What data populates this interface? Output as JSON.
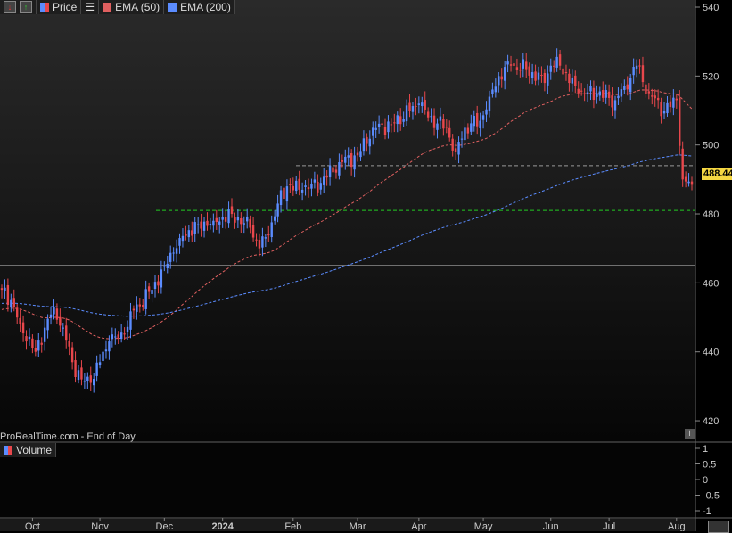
{
  "legend": {
    "price": "Price",
    "ema50": "EMA (50)",
    "ema200": "EMA (200)",
    "volume": "Volume"
  },
  "source": "ProRealTime.com - End of Day",
  "last_price": "488.44",
  "colors": {
    "up": "#5b8cff",
    "down": "#e8474c",
    "ema50": "#e06060",
    "ema200": "#5b8cff",
    "last": "#f5d742"
  },
  "chart_data": {
    "type": "candlestick",
    "title": "",
    "ylim": [
      415,
      542
    ],
    "y_ticks": [
      "540",
      "520",
      "500",
      "480",
      "460",
      "440",
      "420"
    ],
    "y_tick_values": [
      540,
      520,
      500,
      480,
      460,
      440,
      420
    ],
    "x_labels": [
      "Oct",
      "Nov",
      "Dec",
      "2024",
      "Feb",
      "Mar",
      "Apr",
      "May",
      "Jun",
      "Jul",
      "Aug"
    ],
    "x_label_bar_index": [
      10,
      32,
      53,
      72,
      95,
      116,
      136,
      157,
      179,
      198,
      220
    ],
    "total_bars": 226,
    "close_keypoints": [
      [
        0,
        458
      ],
      [
        3,
        455
      ],
      [
        6,
        448
      ],
      [
        11,
        440
      ],
      [
        14,
        447
      ],
      [
        17,
        453
      ],
      [
        20,
        447
      ],
      [
        23,
        437
      ],
      [
        26,
        432
      ],
      [
        29,
        431
      ],
      [
        32,
        437
      ],
      [
        35,
        443
      ],
      [
        40,
        445
      ],
      [
        43,
        452
      ],
      [
        49,
        458
      ],
      [
        53,
        465
      ],
      [
        58,
        473
      ],
      [
        64,
        477
      ],
      [
        69,
        478
      ],
      [
        75,
        480
      ],
      [
        81,
        476
      ],
      [
        84,
        470
      ],
      [
        87,
        474
      ],
      [
        90,
        483
      ],
      [
        93,
        488
      ],
      [
        98,
        487
      ],
      [
        104,
        489
      ],
      [
        110,
        495
      ],
      [
        116,
        497
      ],
      [
        121,
        505
      ],
      [
        127,
        506
      ],
      [
        133,
        510
      ],
      [
        136,
        512
      ],
      [
        139,
        508
      ],
      [
        145,
        505
      ],
      [
        148,
        498
      ],
      [
        151,
        505
      ],
      [
        156,
        507
      ],
      [
        159,
        514
      ],
      [
        162,
        520
      ],
      [
        166,
        523
      ],
      [
        171,
        522
      ],
      [
        177,
        518
      ],
      [
        179,
        523
      ],
      [
        182,
        523
      ],
      [
        188,
        515
      ],
      [
        194,
        515
      ],
      [
        200,
        513
      ],
      [
        203,
        517
      ],
      [
        207,
        523
      ],
      [
        211,
        515
      ],
      [
        216,
        510
      ],
      [
        220,
        513
      ],
      [
        222,
        490
      ],
      [
        225,
        488.44
      ]
    ],
    "levels": [
      {
        "value": 465,
        "style": "solid",
        "color": "#cccccc"
      },
      {
        "value": 494,
        "style": "dashed",
        "color": "#999999"
      },
      {
        "value": 481,
        "style": "dashed",
        "color": "#22cc22"
      }
    ],
    "volume_ticks": [
      "1",
      "0.5",
      "0",
      "-0.5",
      "-1"
    ],
    "volume_tick_values": [
      1,
      0.5,
      0,
      -0.5,
      -1
    ]
  }
}
